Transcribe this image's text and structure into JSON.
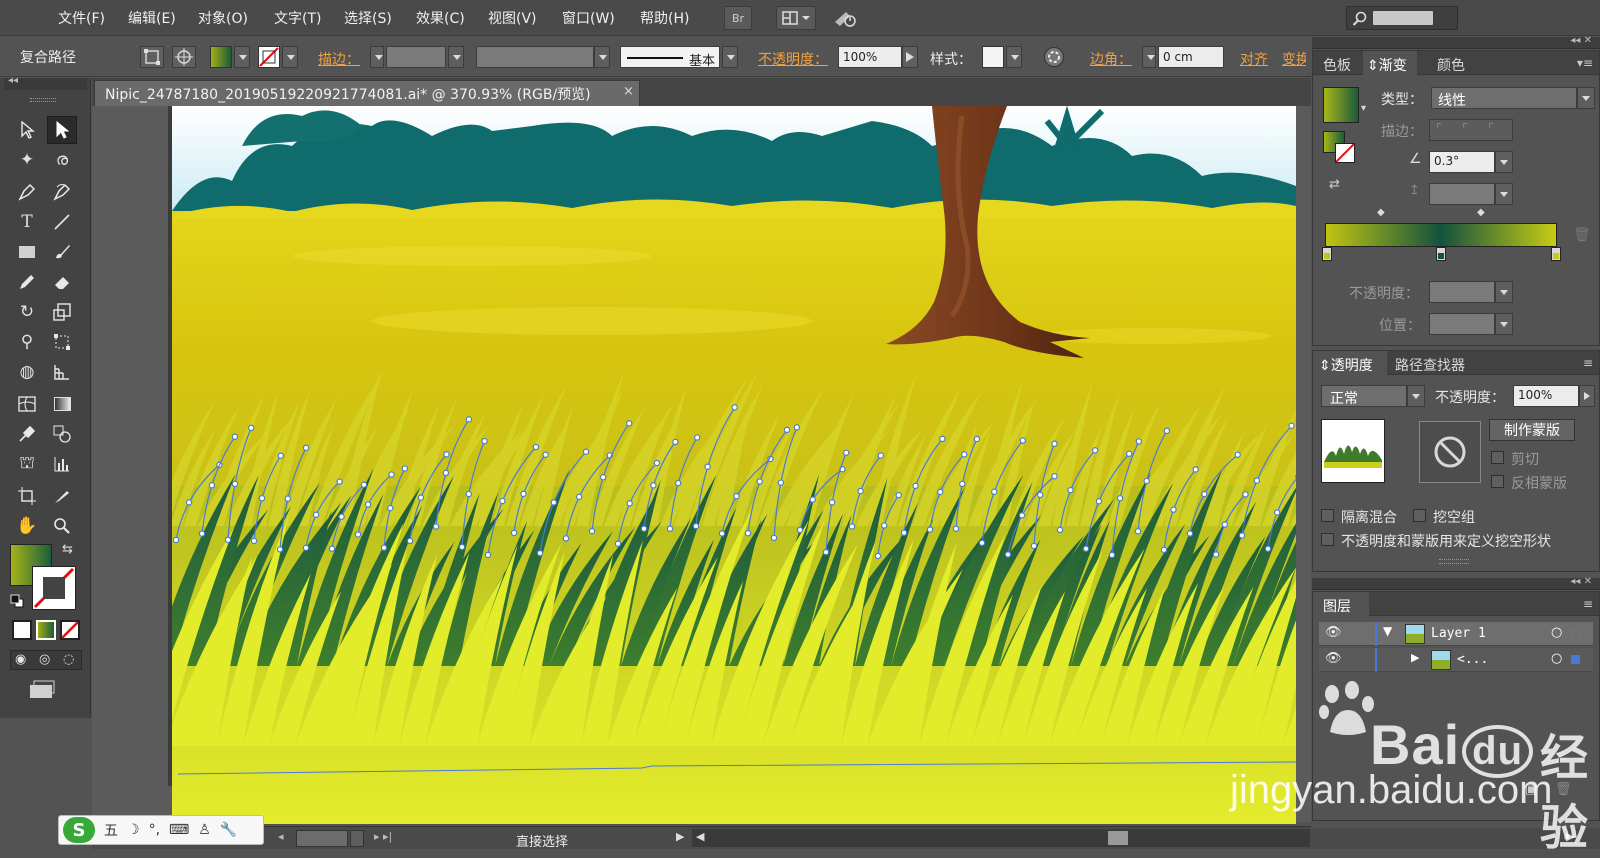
{
  "menu": [
    "文件(F)",
    "编辑(E)",
    "对象(O)",
    "文字(T)",
    "选择(S)",
    "效果(C)",
    "视图(V)",
    "窗口(W)",
    "帮助(H)"
  ],
  "menubar": {
    "bridge_label": "Br"
  },
  "control": {
    "object_type": "复合路径",
    "stroke_label": "描边：",
    "stroke_style": "基本",
    "opacity_label": "不透明度：",
    "opacity_value": "100%",
    "style_label": "样式：",
    "corner_label": "边角：",
    "corner_value": "0 cm",
    "align_label": "对齐",
    "transform_label": "变换"
  },
  "document": {
    "tab_title": "Nipic_24787180_20190519220921774081.ai* @ 370.93% (RGB/预览)",
    "close": "×"
  },
  "status": {
    "tool_name": "直接选择"
  },
  "ime": {
    "logo": "S",
    "mode": "五"
  },
  "gradient_panel": {
    "tabs": [
      "色板",
      "渐变",
      "颜色"
    ],
    "active_tab": "渐变",
    "type_label": "类型：",
    "type_value": "线性",
    "stroke_label": "描边：",
    "angle_value": "0.3°",
    "opacity_label": "不透明度：",
    "location_label": "位置：",
    "colors": {
      "stop_left": "#c0c412",
      "stop_mid": "#13523e",
      "stop_right": "#c8cc14"
    }
  },
  "transparency_panel": {
    "tabs": [
      "透明度",
      "路径查找器"
    ],
    "blend_mode": "正常",
    "opacity_label": "不透明度：",
    "opacity_value": "100%",
    "make_mask_button": "制作蒙版",
    "clip_label": "剪切",
    "invert_mask_label": "反相蒙版",
    "isolate_blending": "隔离混合",
    "knockout_group": "挖空组",
    "opacity_mask_knockout": "不透明度和蒙版用来定义挖空形状"
  },
  "layers_panel": {
    "title": "图层",
    "rows": [
      {
        "name": "Layer 1",
        "expanded": true
      },
      {
        "name": "<..."
      }
    ]
  },
  "watermark": {
    "brand": "Bai",
    "brand_tail": "du",
    "cn": "经验",
    "url": "jingyan.baidu.com"
  },
  "palette": {
    "sky": "#dff3fb",
    "trees": "#0f6a6a",
    "field": "#e2d21a",
    "trunk": "#7a3a1c",
    "grass_dark": "#2b6a2a",
    "grass_light": "#e2ea2a",
    "selection": "#4a7bd6"
  }
}
